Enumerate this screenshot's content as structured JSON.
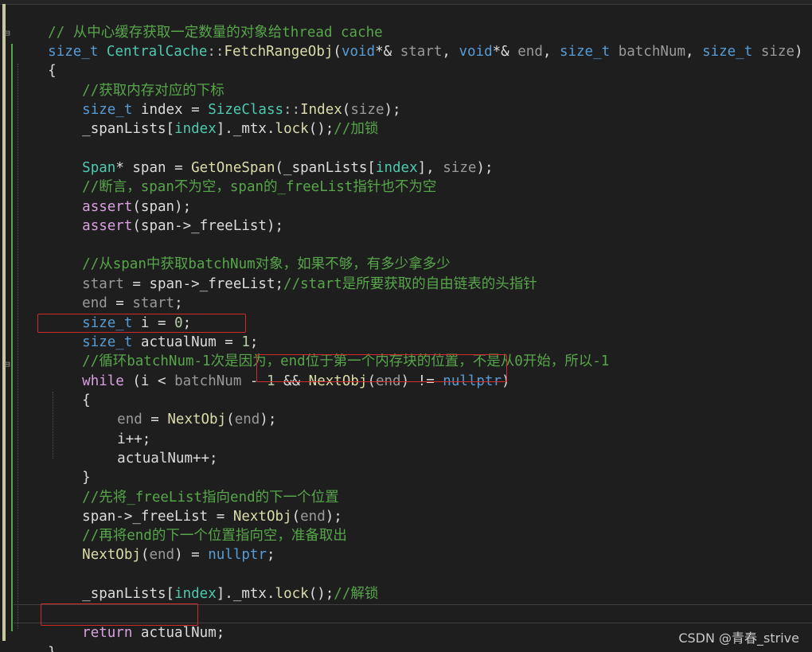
{
  "watermark": "CSDN @青春_strive",
  "code": {
    "l01": "// 从中心缓存获取一定数量的对象给thread cache",
    "l02": {
      "t1": "size_t",
      "t2": "CentralCache",
      "t3": "::",
      "t4": "FetchRangeObj",
      "t5": "(",
      "t6": "void",
      "t7": "*& ",
      "t8": "start",
      "t9": ", ",
      "t10": "void",
      "t11": "*& ",
      "t12": "end",
      "t13": ", ",
      "t14": "size_t",
      "t15": " ",
      "t16": "batchNum",
      "t17": ", ",
      "t18": "size_t",
      "t19": " ",
      "t20": "size",
      "t21": ")"
    },
    "l03": "{",
    "l04": "//获取内存对应的下标",
    "l05": {
      "t1": "size_t",
      "t2": " index = ",
      "t3": "SizeClass",
      "t4": "::",
      "t5": "Index",
      "t6": "(",
      "t7": "size",
      "t8": ");"
    },
    "l06": {
      "t1": "_spanLists",
      "t2": "[",
      "t3": "index",
      "t4": "].",
      "t5": "_mtx",
      "t6": ".",
      "t7": "lock",
      "t8": "();",
      "t9": "//加锁"
    },
    "l08": {
      "t1": "Span",
      "t2": "* span = ",
      "t3": "GetOneSpan",
      "t4": "(",
      "t5": "_spanLists",
      "t6": "[",
      "t7": "index",
      "t8": "], ",
      "t9": "size",
      "t10": ");"
    },
    "l09": "//断言，span不为空，span的_freeList指针也不为空",
    "l10": {
      "t1": "assert",
      "t2": "(span);"
    },
    "l11": {
      "t1": "assert",
      "t2": "(span->",
      "t3": "_freeList",
      "t4": ");"
    },
    "l13": "//从span中获取batchNum对象，如果不够，有多少拿多少",
    "l14": {
      "t1": "start",
      "t2": " = span->",
      "t3": "_freeList",
      "t4": ";",
      "t5": "//start是所要获取的自由链表的头指针"
    },
    "l15": {
      "t1": "end",
      "t2": " = ",
      "t3": "start",
      "t4": ";"
    },
    "l16": {
      "t1": "size_t",
      "t2": " i = ",
      "t3": "0",
      "t4": ";"
    },
    "l17": {
      "t1": "size_t",
      "t2": " actualNum = ",
      "t3": "1",
      "t4": ";"
    },
    "l18": "//循环batchNum-1次是因为，end位于第一个内存块的位置，不是从0开始，所以-1",
    "l19": {
      "t1": "while",
      "t2": " (i < ",
      "t3": "batchNum",
      "t4": " - ",
      "t5": "1",
      "t6": " && ",
      "t7": "NextObj",
      "t8": "(",
      "t9": "end",
      "t10": ") != ",
      "t11": "nullptr",
      "t12": ")"
    },
    "l20": "{",
    "l21": {
      "t1": "end",
      "t2": " = ",
      "t3": "NextObj",
      "t4": "(",
      "t5": "end",
      "t6": ");"
    },
    "l22": "i++;",
    "l23": "actualNum++;",
    "l24": "}",
    "l25": "//先将_freeList指向end的下一个位置",
    "l26": {
      "t1": "span->",
      "t2": "_freeList",
      "t3": " = ",
      "t4": "NextObj",
      "t5": "(",
      "t6": "end",
      "t7": ");"
    },
    "l27": "//再将end的下一个位置指向空，准备取出",
    "l28": {
      "t1": "NextObj",
      "t2": "(",
      "t3": "end",
      "t4": ") = ",
      "t5": "nullptr",
      "t6": ";"
    },
    "l30": {
      "t1": "_spanLists",
      "t2": "[",
      "t3": "index",
      "t4": "].",
      "t5": "_mtx",
      "t6": ".",
      "t7": "lock",
      "t8": "();",
      "t9": "//解锁"
    },
    "l32": {
      "t1": "return",
      "t2": " actualNum;"
    },
    "l33": "}"
  },
  "colors": {
    "background": "#1e1e1e",
    "keyword": "#569cd6",
    "control_keyword": "#d8a0df",
    "type": "#4ec9b0",
    "function": "#dcdcaa",
    "comment": "#57a64a",
    "highlight_box": "#d12c2c"
  }
}
